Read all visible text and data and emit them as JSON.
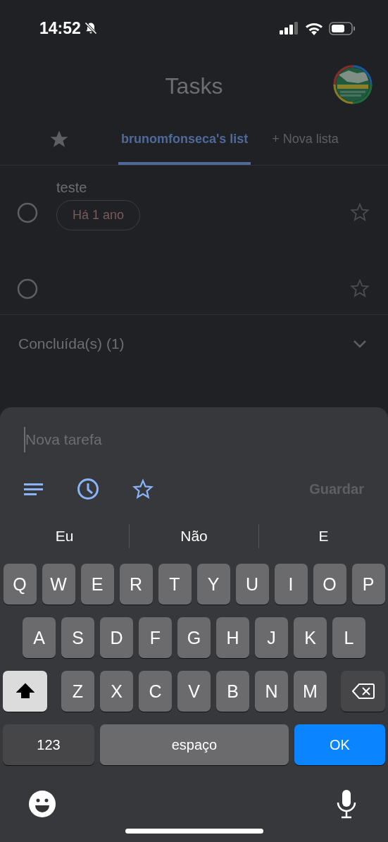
{
  "status_bar": {
    "time": "14:52",
    "silent": true
  },
  "header": {
    "title": "Tasks"
  },
  "tabs": [
    {
      "kind": "starred",
      "selected": false
    },
    {
      "kind": "list",
      "label": "brunomfonseca's list",
      "selected": true
    },
    {
      "kind": "new",
      "label": "+ Nova lista",
      "selected": false
    }
  ],
  "tasks": [
    {
      "title": "teste",
      "due": "Há 1 ano",
      "completed": false,
      "starred": false
    },
    {
      "completed": false,
      "starred": false
    }
  ],
  "completed_section": {
    "label": "Concluída(s) (1)",
    "expanded": false
  },
  "new_task": {
    "placeholder": "Nova tarefa",
    "save_label": "Guardar",
    "save_disabled": true
  },
  "suggestions": [
    "Eu",
    "Não",
    "E"
  ],
  "keyboard": {
    "rows": [
      {
        "keys": [
          {
            "kind": "letter",
            "label": "Q"
          },
          {
            "kind": "letter",
            "label": "W"
          },
          {
            "kind": "letter",
            "label": "E"
          },
          {
            "kind": "letter",
            "label": "R"
          },
          {
            "kind": "letter",
            "label": "T"
          },
          {
            "kind": "letter",
            "label": "Y"
          },
          {
            "kind": "letter",
            "label": "U"
          },
          {
            "kind": "letter",
            "label": "I"
          },
          {
            "kind": "letter",
            "label": "O"
          },
          {
            "kind": "letter",
            "label": "P"
          }
        ]
      },
      {
        "keys": [
          {
            "kind": "letter",
            "label": "A"
          },
          {
            "kind": "letter",
            "label": "S"
          },
          {
            "kind": "letter",
            "label": "D"
          },
          {
            "kind": "letter",
            "label": "F"
          },
          {
            "kind": "letter",
            "label": "G"
          },
          {
            "kind": "letter",
            "label": "H"
          },
          {
            "kind": "letter",
            "label": "J"
          },
          {
            "kind": "letter",
            "label": "K"
          },
          {
            "kind": "letter",
            "label": "L"
          }
        ]
      },
      {
        "keys": [
          {
            "kind": "shift",
            "on": true
          },
          {
            "kind": "letter",
            "label": "Z"
          },
          {
            "kind": "letter",
            "label": "X"
          },
          {
            "kind": "letter",
            "label": "C"
          },
          {
            "kind": "letter",
            "label": "V"
          },
          {
            "kind": "letter",
            "label": "B"
          },
          {
            "kind": "letter",
            "label": "N"
          },
          {
            "kind": "letter",
            "label": "M"
          },
          {
            "kind": "backspace"
          }
        ]
      },
      {
        "keys": [
          {
            "kind": "numbers",
            "label": "123"
          },
          {
            "kind": "space",
            "label": "espaço"
          },
          {
            "kind": "return",
            "label": "OK"
          }
        ]
      }
    ]
  }
}
